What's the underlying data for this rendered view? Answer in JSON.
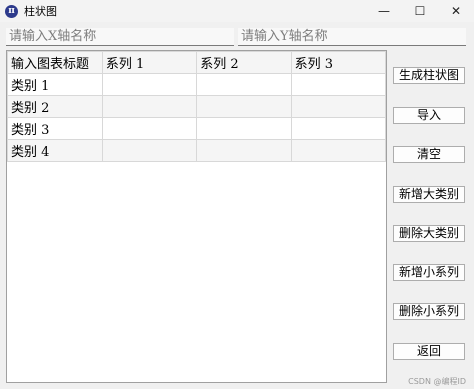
{
  "window": {
    "title": "柱状图",
    "app_icon_glyph": "π",
    "minimize_glyph": "—",
    "maximize_glyph": "☐",
    "close_glyph": "✕"
  },
  "inputs": {
    "x_axis_placeholder": "请输入X轴名称",
    "y_axis_placeholder": "请输入Y轴名称"
  },
  "table": {
    "header": [
      "输入图表标题",
      "系列 1",
      "系列 2",
      "系列 3"
    ],
    "rows": [
      [
        "类别 1",
        "",
        "",
        ""
      ],
      [
        "类别 2",
        "",
        "",
        ""
      ],
      [
        "类别 3",
        "",
        "",
        ""
      ],
      [
        "类别 4",
        "",
        "",
        ""
      ]
    ]
  },
  "buttons": {
    "generate": "生成柱状图",
    "import": "导入",
    "clear": "清空",
    "add_major_category": "新增大类别",
    "delete_major_category": "删除大类别",
    "add_minor_series": "新增小系列",
    "delete_minor_series": "删除小系列",
    "back": "返回"
  },
  "watermark": "CSDN @编程ID"
}
